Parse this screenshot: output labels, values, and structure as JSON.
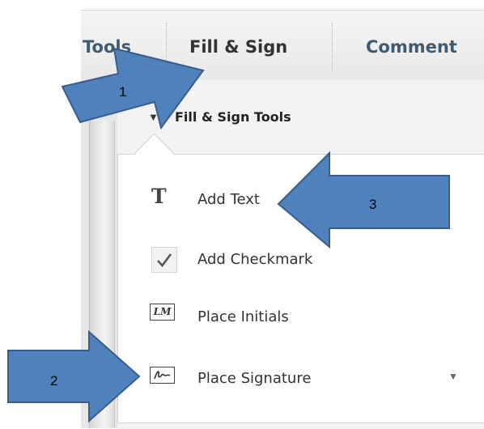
{
  "toolbar": {
    "tabs": [
      {
        "label": "Tools"
      },
      {
        "label": "Fill & Sign"
      },
      {
        "label": "Comment"
      }
    ]
  },
  "panel": {
    "section_title": "Fill & Sign Tools",
    "items": [
      {
        "label": "Add Text",
        "icon": "text-T-icon"
      },
      {
        "label": "Add Checkmark",
        "icon": "checkmark-icon"
      },
      {
        "label": "Place Initials",
        "icon": "initials-icon",
        "icon_text": "LM"
      },
      {
        "label": "Place Signature",
        "icon": "signature-icon"
      }
    ]
  },
  "annotations": [
    {
      "number": "1"
    },
    {
      "number": "2"
    },
    {
      "number": "3"
    }
  ],
  "colors": {
    "arrow_fill": "#4f81bd",
    "arrow_stroke": "#385d8a",
    "tab_text": "#3d5c73"
  }
}
